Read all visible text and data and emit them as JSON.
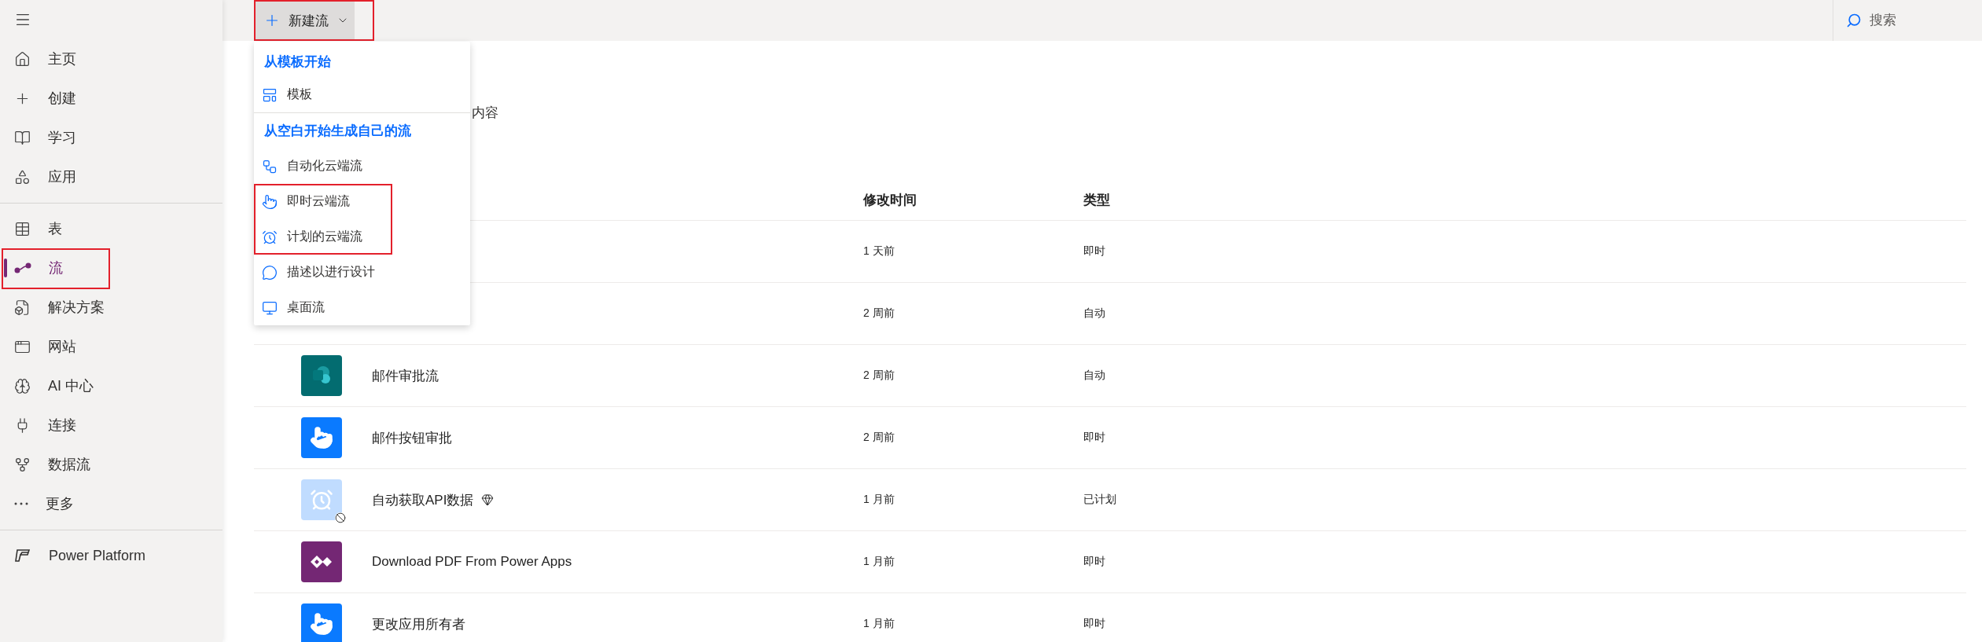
{
  "top_bar": {
    "new_button": {
      "label": "新建流",
      "highlighted": true
    },
    "search": {
      "placeholder": "搜索"
    }
  },
  "sidebar": {
    "sections": [
      [
        {
          "label": "主页",
          "selected": false,
          "highlighted": false
        },
        {
          "label": "创建",
          "selected": false,
          "highlighted": false
        },
        {
          "label": "学习",
          "selected": false,
          "highlighted": false
        },
        {
          "label": "应用",
          "selected": false,
          "highlighted": false
        }
      ],
      [
        {
          "label": "表",
          "selected": false,
          "highlighted": false
        },
        {
          "label": "流",
          "selected": true,
          "highlighted": true
        },
        {
          "label": "解决方案",
          "selected": false,
          "highlighted": false
        },
        {
          "label": "网站",
          "selected": false,
          "highlighted": false
        },
        {
          "label": "AI 中心",
          "selected": false,
          "highlighted": false
        },
        {
          "label": "连接",
          "selected": false,
          "highlighted": false
        },
        {
          "label": "数据流",
          "selected": false,
          "highlighted": false
        },
        {
          "label": "更多",
          "selected": false,
          "highlighted": false
        }
      ],
      [
        {
          "label": "Power Platform",
          "selected": false,
          "highlighted": false
        }
      ]
    ]
  },
  "new_menu": {
    "sections": [
      {
        "header": "从模板开始",
        "items": [
          {
            "label": "模板",
            "highlighted": false
          }
        ]
      },
      {
        "header": "从空白开始生成自己的流",
        "items": [
          {
            "label": "自动化云端流",
            "highlighted": false
          },
          {
            "label": "即时云端流",
            "highlighted": true
          },
          {
            "label": "计划的云端流",
            "highlighted": true
          },
          {
            "label": "描述以进行设计",
            "highlighted": false
          },
          {
            "label": "桌面流",
            "highlighted": false
          }
        ]
      }
    ]
  },
  "subtitle": "内容",
  "table": {
    "columns": [
      "修改时间",
      "类型"
    ],
    "rows": [
      {
        "modified": "1 天前",
        "type": "即时"
      },
      {
        "modified": "2 周前",
        "type": "自动"
      },
      {
        "kind": "sharepoint",
        "name": "邮件审批流",
        "modified": "2 周前",
        "type": "自动",
        "disabled": false,
        "premium": false
      },
      {
        "kind": "button",
        "name": "邮件按钮审批",
        "modified": "2 周前",
        "type": "即时",
        "disabled": false,
        "premium": false
      },
      {
        "kind": "schedule",
        "name": "自动获取API数据",
        "modified": "1 月前",
        "type": "已计划",
        "disabled": true,
        "premium": true
      },
      {
        "kind": "powerapps",
        "name": "Download PDF From Power Apps",
        "modified": "1 月前",
        "type": "即时",
        "disabled": false,
        "premium": false
      },
      {
        "kind": "button",
        "name": "更改应用所有者",
        "modified": "1 月前",
        "type": "即时",
        "disabled": false,
        "premium": false
      }
    ]
  }
}
